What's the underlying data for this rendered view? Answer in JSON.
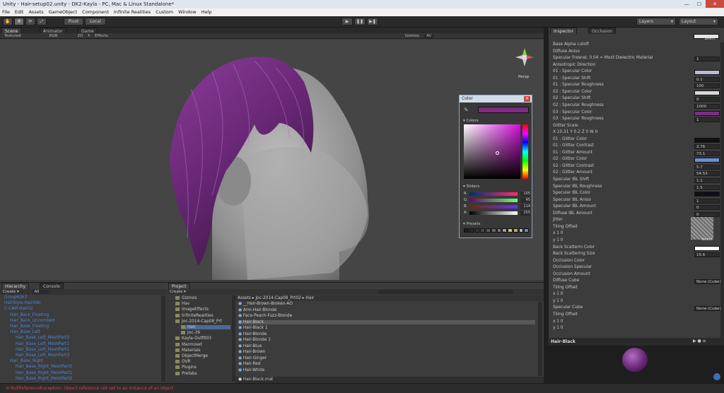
{
  "titlebar": {
    "text": "Unity - Hair-setup02.unity - DK2-Kayla - PC, Mac & Linux Standalone*"
  },
  "menu": [
    "File",
    "Edit",
    "Assets",
    "GameObject",
    "Component",
    "Infinite Realities",
    "Custom",
    "Window",
    "Help"
  ],
  "toolbar": {
    "pivot": "Pivot",
    "local": "Local",
    "layers": "Layers",
    "layout": "Layout",
    "play_icon": "play-icon",
    "pause_icon": "pause-icon",
    "step_icon": "step-icon"
  },
  "tabs": {
    "scene": "Scene",
    "animator": "Animator",
    "game": "Game",
    "inspector": "Inspector",
    "occlusion": "Occlusion",
    "hierarchy": "Hierarchy",
    "console": "Console",
    "project": "Project"
  },
  "scenebar": {
    "shading": "Textured",
    "rgb": "RGB",
    "mode2d": "2D",
    "effects": "Effects",
    "gizmos": "Gizmos",
    "search": "All"
  },
  "viewport": {
    "persp": "Persp"
  },
  "colorpicker": {
    "title": "Color",
    "colors_label": "Colors",
    "sliders_label": "Sliders",
    "presets_label": "Presets",
    "current": "#7d2c86",
    "sliders": [
      {
        "name": "R",
        "value": "105"
      },
      {
        "name": "G",
        "value": "45"
      },
      {
        "name": "B",
        "value": "114"
      },
      {
        "name": "A",
        "value": "255"
      }
    ],
    "presets": [
      "#1e1e1e",
      "#2a2a2a",
      "#393939",
      "#4a4a4a",
      "#5c5c5c",
      "#6c6c6c",
      "#7b7b7b",
      "#9e9e9e",
      "#d7c38b",
      "#c7a85a",
      "#b0b6d8",
      "#6e86c8"
    ]
  },
  "hierarchy": {
    "create": "Create",
    "search": "All",
    "items": [
      {
        "label": "Group6267",
        "indent": 0
      },
      {
        "label": "HairStyle-Hair04b",
        "indent": 0
      },
      {
        "label": "C-CAM-Hair02",
        "indent": 0
      },
      {
        "label": "Hair_Back_Floating",
        "indent": 1
      },
      {
        "label": "Hair_Back_Uncombed",
        "indent": 1
      },
      {
        "label": "Hair_Base_Floating",
        "indent": 1
      },
      {
        "label": "Hair_Base_Left",
        "indent": 1
      },
      {
        "label": "Hair_Base_Left_MeshPart0",
        "indent": 2
      },
      {
        "label": "Hair_Base_Left_MeshPart1",
        "indent": 2
      },
      {
        "label": "Hair_Base_Left_MeshPart2",
        "indent": 2
      },
      {
        "label": "Hair_Base_Left_MeshPart3",
        "indent": 2
      },
      {
        "label": "Hair_Base_Right",
        "indent": 1
      },
      {
        "label": "Hair_Base_Right_MeshPart0",
        "indent": 2
      },
      {
        "label": "Hair_Base_Right_MeshPart1",
        "indent": 2
      },
      {
        "label": "Hair_Base_Right_MeshPart2",
        "indent": 2
      }
    ]
  },
  "project": {
    "create": "Create",
    "breadcrumb": "Assets ▸ Joc-2014-Cap08_Prt02 ▸ Hair",
    "folders": [
      "Gizmos",
      "Hav",
      "ImageEffects",
      "InfiniteRealities",
      "Joc-2014-Cap08_Prt",
      "Hair",
      "Joc-39",
      "Kayla-Outfit03",
      "Marmoset",
      "Materials",
      "ObjectMerge",
      "OVR",
      "Plugins",
      "Prefabs"
    ],
    "files": [
      "__Hair-Brown-Broken-AO",
      "Arm-Hair-Blonde",
      "Face-Peach-Fuzz-Blonde",
      "Hair-Black",
      "Hair-Black 1",
      "Hair-Blonde",
      "Hair-Blonde 1",
      "Hair-Blue",
      "Hair-Brown",
      "Hair-Ginger",
      "Hair-Red",
      "Hair-White"
    ],
    "selected_file": "Hair-Black.mat"
  },
  "inspector": {
    "rows": [
      {
        "label": "Base Alpha cutoff",
        "value": ""
      },
      {
        "label": "Diffuse Aniso",
        "value": ""
      },
      {
        "label": "Specular Fresnel, 0.04 = Most Dielectric Material",
        "value": "1"
      },
      {
        "label": "Anisotropic Direction",
        "value": ""
      },
      {
        "label": "01 : Specular Color",
        "swatch": "#b8bad8"
      },
      {
        "label": "01 : Specular Shift",
        "value": "0.1"
      },
      {
        "label": "01 : Specular Roughness",
        "value": "100"
      },
      {
        "label": "02 : Specular Color",
        "swatch": "#d8d8d8"
      },
      {
        "label": "02 : Specular Shift",
        "value": "0"
      },
      {
        "label": "02 : Specular Roughness",
        "value": "1000"
      },
      {
        "label": "03 : Specular Color",
        "swatch": "#7d2c86"
      },
      {
        "label": "03 : Specular Roughness",
        "value": "1"
      },
      {
        "label": "Glitter Scale",
        "value": ""
      },
      {
        "label": "X 10.31          Y 0.2          Z 0          W 0",
        "value": ""
      },
      {
        "label": "01 : Glitter Color",
        "swatch": "#111111"
      },
      {
        "label": "01 : Glitter Contrast",
        "value": "2.76"
      },
      {
        "label": "01 : Glitter Amount",
        "value": "73.1"
      },
      {
        "label": "02 : Glitter Color",
        "swatch": "#6a8ed8"
      },
      {
        "label": "02 : Glitter Contrast",
        "value": "5.7"
      },
      {
        "label": "02 : Glitter Amount",
        "value": "54.53"
      },
      {
        "label": "Specular IBL Shift",
        "value": "1.1"
      },
      {
        "label": "Specular IBL Roughness",
        "value": "1.5"
      },
      {
        "label": "Specular IBL Color",
        "swatch": "#101018"
      },
      {
        "label": "Specular IBL Aniso",
        "value": "1"
      },
      {
        "label": "Specular IBL Amount",
        "value": "0"
      },
      {
        "label": "Diffuse IBL Amount",
        "value": "0"
      },
      {
        "label": "Jitter",
        "value": ""
      },
      {
        "label": "Tiling                    Offset",
        "value": ""
      },
      {
        "label": "x 1                          0",
        "value": ""
      },
      {
        "label": "y 1                          0",
        "value": ""
      },
      {
        "label": "Back Scatterin Color",
        "swatch": "#ffffff"
      },
      {
        "label": "Back Scattering Size",
        "value": "15.6"
      },
      {
        "label": "Occlusion Color",
        "value": ""
      },
      {
        "label": "Occlusion Specular",
        "value": ""
      },
      {
        "label": "Occlusion Amount",
        "value": ""
      },
      {
        "label": "Diffuse Cube",
        "value": "None (Cubemap)"
      },
      {
        "label": "Tiling                    Offset",
        "value": ""
      },
      {
        "label": "x 1                          0",
        "value": ""
      },
      {
        "label": "y 1                          0",
        "value": ""
      },
      {
        "label": "Specular Cube",
        "value": "None (Cubemap)"
      },
      {
        "label": "Tiling                    Offset",
        "value": ""
      },
      {
        "label": "x 1                          0",
        "value": ""
      },
      {
        "label": "y 1                          0",
        "value": ""
      }
    ],
    "select_label": "Select",
    "preview_title": "Hair-Black"
  },
  "status": {
    "message": "NullReferenceException: Object reference not set to an instance of an object"
  }
}
